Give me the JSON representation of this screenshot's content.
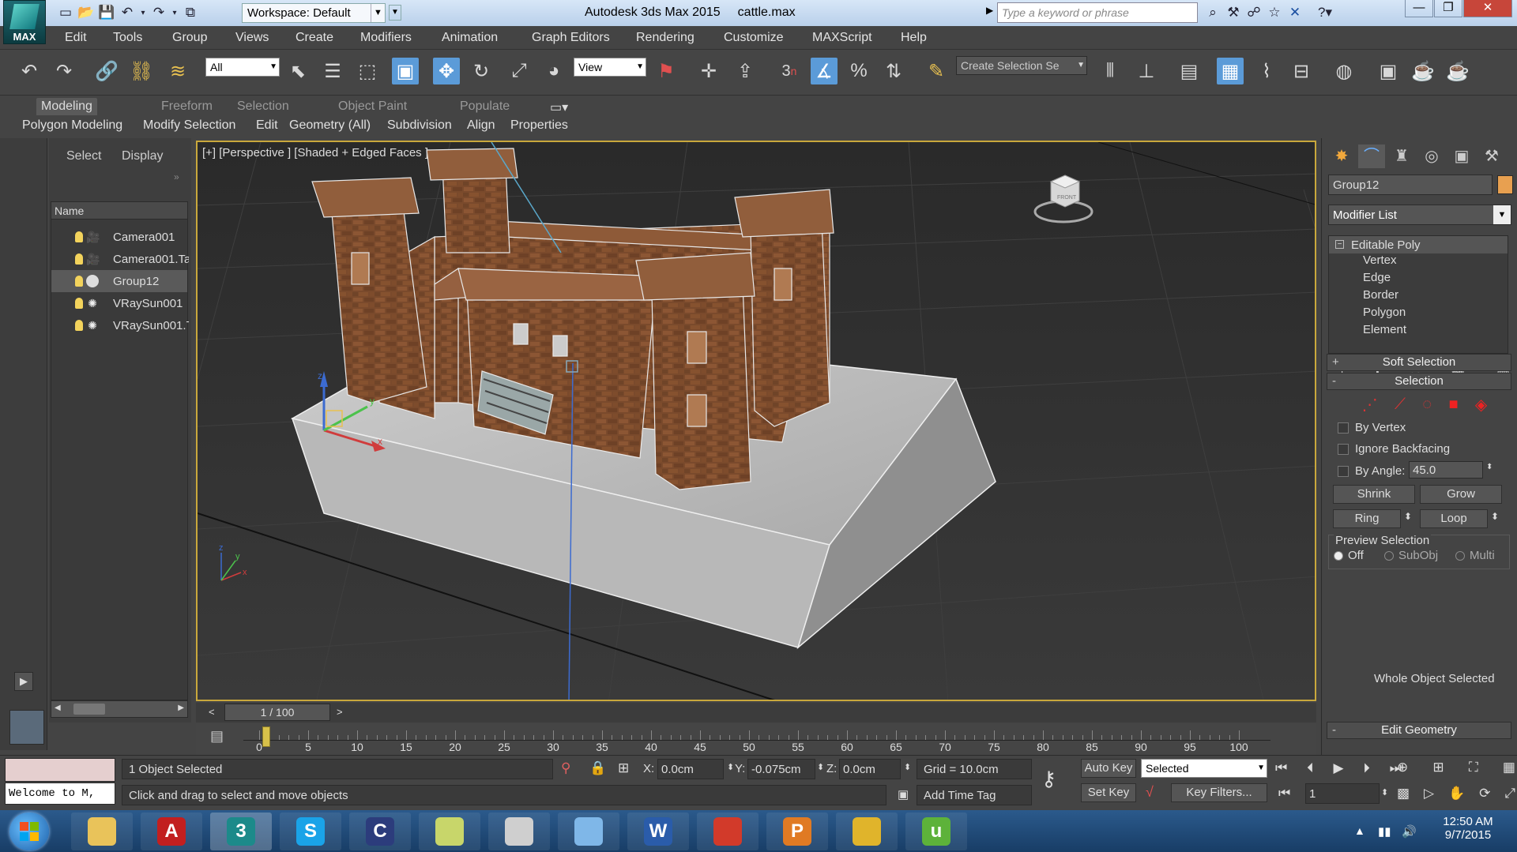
{
  "titlebar": {
    "logo_label": "MAX",
    "workspace": "Workspace: Default",
    "app_title": "Autodesk 3ds Max 2015",
    "file_name": "cattle.max",
    "search_placeholder": "Type a keyword or phrase"
  },
  "menu": [
    "Edit",
    "Tools",
    "Group",
    "Views",
    "Create",
    "Modifiers",
    "Animation",
    "Graph Editors",
    "Rendering",
    "Customize",
    "MAXScript",
    "Help"
  ],
  "toolbar": {
    "selection_filter": "All",
    "ref_coord": "View",
    "named_selection": "Create Selection Se",
    "snap_label": "3"
  },
  "ribbon": {
    "tabs": [
      "Modeling",
      "Freeform",
      "Selection",
      "Object Paint",
      "Populate"
    ],
    "subtabs": [
      "Polygon Modeling",
      "Modify Selection",
      "Edit",
      "Geometry (All)",
      "Subdivision",
      "Align",
      "Properties"
    ]
  },
  "scene_explorer": {
    "tab_select": "Select",
    "tab_display": "Display",
    "column_name": "Name",
    "items": [
      {
        "name": "Camera001",
        "icon": "camera-icon",
        "selected": false
      },
      {
        "name": "Camera001.Ta",
        "icon": "camera-icon",
        "selected": false
      },
      {
        "name": "Group12",
        "icon": "group-icon",
        "selected": true
      },
      {
        "name": "VRaySun001",
        "icon": "sun-icon",
        "selected": false
      },
      {
        "name": "VRaySun001.T",
        "icon": "sun-icon",
        "selected": false
      }
    ]
  },
  "viewport": {
    "label": "[+] [Perspective ] [Shaded + Edged Faces ]",
    "viewcube_text": "FRONT"
  },
  "time": {
    "frame_display": "1 / 100",
    "ticks": [
      "0",
      "5",
      "10",
      "15",
      "20",
      "25",
      "30",
      "35",
      "40",
      "45",
      "50",
      "55",
      "60",
      "65",
      "70",
      "75",
      "80",
      "85",
      "90",
      "95",
      "100"
    ]
  },
  "command_panel": {
    "object_name": "Group12",
    "object_color": "#e8a050",
    "modifier_list": "Modifier List",
    "stack": {
      "base": "Editable Poly",
      "subobjects": [
        "Vertex",
        "Edge",
        "Border",
        "Polygon",
        "Element"
      ]
    },
    "rollouts": {
      "soft_selection": "Soft Selection",
      "selection": "Selection",
      "edit_geometry": "Edit Geometry"
    },
    "selection": {
      "by_vertex": "By Vertex",
      "ignore_backfacing": "Ignore Backfacing",
      "by_angle": "By Angle:",
      "angle_value": "45.0",
      "shrink": "Shrink",
      "grow": "Grow",
      "ring": "Ring",
      "loop": "Loop",
      "preview_selection": "Preview Selection",
      "preview_off": "Off",
      "preview_subobj": "SubObj",
      "preview_multi": "Multi",
      "status": "Whole Object Selected"
    }
  },
  "status": {
    "listener": "Welcome to M,",
    "selected_count": "1 Object Selected",
    "prompt": "Click and drag to select and move objects",
    "x_label": "X:",
    "x": "0.0cm",
    "y_label": "Y:",
    "y": "-0.075cm",
    "z_label": "Z:",
    "z": "0.0cm",
    "grid": "Grid = 10.0cm",
    "add_time_tag": "Add Time Tag",
    "auto_key": "Auto Key",
    "set_key": "Set Key",
    "key_mode": "Selected",
    "key_filters": "Key Filters...",
    "current_frame": "1"
  },
  "taskbar": {
    "clock_time": "12:50 AM",
    "clock_date": "9/7/2015",
    "apps": [
      {
        "name": "explorer",
        "glyph": "",
        "color": "#e9c35a"
      },
      {
        "name": "autocad",
        "glyph": "A",
        "color": "#c21f1f"
      },
      {
        "name": "3dsmax",
        "glyph": "3",
        "color": "#1c8a8a"
      },
      {
        "name": "skype",
        "glyph": "S",
        "color": "#1aa3e8"
      },
      {
        "name": "cinema4d",
        "glyph": "C",
        "color": "#2c3c7c"
      },
      {
        "name": "sticky",
        "glyph": "",
        "color": "#c8d66a"
      },
      {
        "name": "character",
        "glyph": "",
        "color": "#cfcfcf"
      },
      {
        "name": "photos",
        "glyph": "",
        "color": "#7fb7e8"
      },
      {
        "name": "word",
        "glyph": "W",
        "color": "#2a5caa"
      },
      {
        "name": "sketchup",
        "glyph": "",
        "color": "#d23a2a"
      },
      {
        "name": "powerpoint",
        "glyph": "P",
        "color": "#e07a23"
      },
      {
        "name": "chrome",
        "glyph": "",
        "color": "#e0b42b"
      },
      {
        "name": "utorrent",
        "glyph": "u",
        "color": "#5db23a"
      }
    ]
  }
}
